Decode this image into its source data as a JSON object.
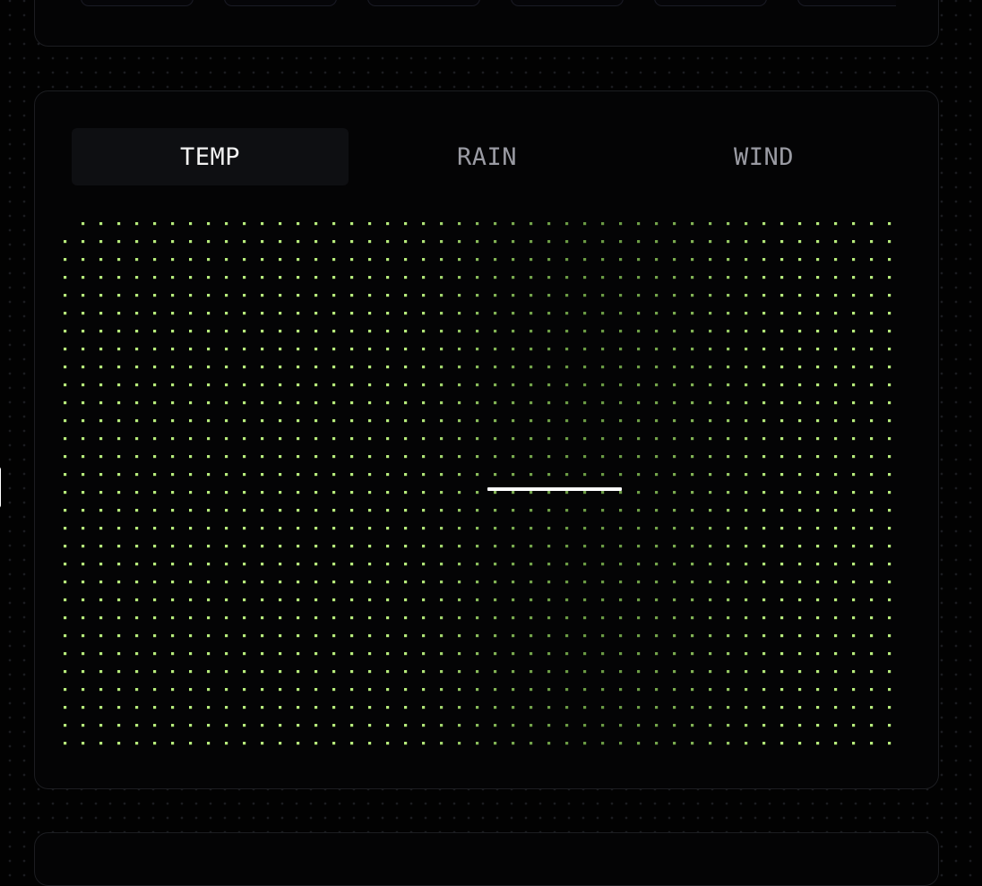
{
  "tabs": [
    {
      "label": "TEMP",
      "active": true
    },
    {
      "label": "RAIN",
      "active": false
    },
    {
      "label": "WIND",
      "active": false
    }
  ],
  "dot_matrix": {
    "columns": 47,
    "rows": 30,
    "hot_color": "#b7ec7c",
    "cool_color": "#5d8c3a"
  },
  "colors": {
    "background": "#020202",
    "card": "#040405",
    "active_tab_bg": "#0e0f12",
    "active_tab_text": "#f2f2f2",
    "inactive_tab_text": "#9a9ba3"
  }
}
